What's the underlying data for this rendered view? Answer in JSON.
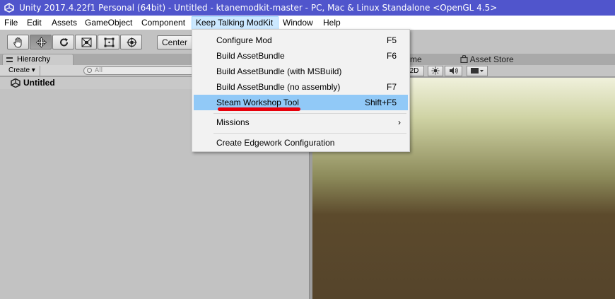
{
  "window": {
    "title": "Unity 2017.4.22f1 Personal (64bit) - Untitled - ktanemodkit-master - PC, Mac & Linux Standalone <OpenGL 4.5>"
  },
  "menubar": {
    "items": [
      "File",
      "Edit",
      "Assets",
      "GameObject",
      "Component",
      "Keep Talking ModKit",
      "Window",
      "Help"
    ],
    "open_menu": "Keep Talking ModKit"
  },
  "toolbar": {
    "tools": [
      {
        "icon": "hand-icon",
        "active": false
      },
      {
        "icon": "move-icon",
        "active": true
      },
      {
        "icon": "rotate-icon",
        "active": false
      },
      {
        "icon": "scale-icon",
        "active": false
      },
      {
        "icon": "rect-tool-icon",
        "active": false
      },
      {
        "icon": "transform-tool-icon",
        "active": false
      }
    ],
    "pivot_label": "Center"
  },
  "hierarchy": {
    "tab_label": "Hierarchy",
    "create_label": "Create ▾",
    "search_placeholder": "All",
    "scene_name": "Untitled"
  },
  "scene_panel": {
    "tabs": [
      "me",
      "Asset Store"
    ],
    "toolbar": {
      "mode_2d": "2D"
    }
  },
  "dropdown": {
    "items": [
      {
        "label": "Configure Mod",
        "shortcut": "F5"
      },
      {
        "label": "Build AssetBundle",
        "shortcut": "F6"
      },
      {
        "label": "Build AssetBundle (with MSBuild)",
        "shortcut": ""
      },
      {
        "label": "Build AssetBundle (no assembly)",
        "shortcut": "F7"
      },
      {
        "label": "Steam Workshop Tool",
        "shortcut": "Shift+F5",
        "highlighted": true
      },
      {
        "label": "Missions",
        "submenu_arrow": "›"
      },
      {
        "label": "Create Edgework Configuration",
        "shortcut": ""
      }
    ]
  },
  "colors": {
    "titlebar": "#5055cc",
    "highlight": "#91c9f7",
    "annotation_underline": "#e8000b"
  }
}
